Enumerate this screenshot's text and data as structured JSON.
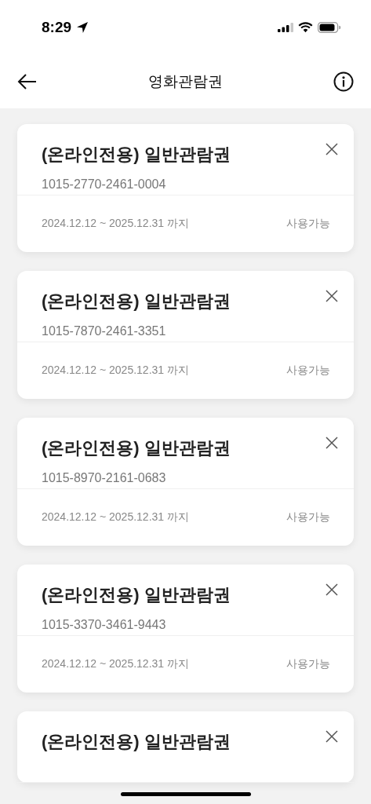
{
  "status_bar": {
    "time": "8:29"
  },
  "header": {
    "title": "영화관람권"
  },
  "tickets": [
    {
      "title": "(온라인전용) 일반관람권",
      "number": "1015-2770-2461-0004",
      "period": "2024.12.12 ~ 2025.12.31 까지",
      "status": "사용가능"
    },
    {
      "title": "(온라인전용) 일반관람권",
      "number": "1015-7870-2461-3351",
      "period": "2024.12.12 ~ 2025.12.31 까지",
      "status": "사용가능"
    },
    {
      "title": "(온라인전용) 일반관람권",
      "number": "1015-8970-2161-0683",
      "period": "2024.12.12 ~ 2025.12.31 까지",
      "status": "사용가능"
    },
    {
      "title": "(온라인전용) 일반관람권",
      "number": "1015-3370-3461-9443",
      "period": "2024.12.12 ~ 2025.12.31 까지",
      "status": "사용가능"
    },
    {
      "title": "(온라인전용) 일반관람권"
    }
  ]
}
